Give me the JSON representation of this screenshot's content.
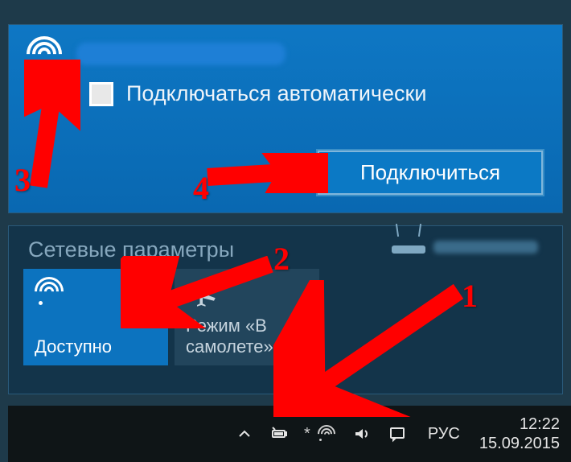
{
  "top": {
    "auto_connect_label": "Подключаться автоматически",
    "connect_button": "Подключиться"
  },
  "bottom": {
    "title": "Сетевые параметры",
    "wifi_tile": "Доступно",
    "airplane_tile": "Режим «В самолете»"
  },
  "taskbar": {
    "lang": "РУС",
    "time": "12:22",
    "date": "15.09.2015"
  },
  "annotations": {
    "n1": "1",
    "n2": "2",
    "n3": "3",
    "n4": "4"
  }
}
